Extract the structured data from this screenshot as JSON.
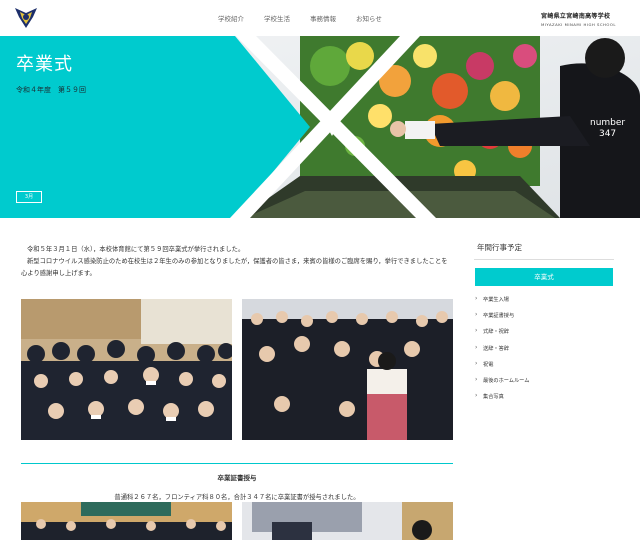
{
  "header": {
    "nav": [
      "学校紹介",
      "学校生活",
      "事務情報",
      "お知らせ"
    ],
    "school_name_jp": "宮崎県立宮崎南高等学校",
    "school_name_en": "MIYAZAKI MINAMI HIGH SCHOOL"
  },
  "hero": {
    "title": "卒業式",
    "subtitle": "令和４年度　第５９回",
    "month_label": "3月",
    "number_label": "number",
    "number_value": "347",
    "accent_color": "#00cbce"
  },
  "intro": [
    "令和５年３月１日（水），本校体育館にて第５９回卒業式が挙行されました。",
    "新型コロナウイルス感染防止のため在校生は２年生のみの参加となりましたが，保護者の皆さま，来賓の皆様のご臨席を賜り，挙行できましたことを心より感謝申し上げます。"
  ],
  "section": {
    "title": "卒業証書授与",
    "text": "普通科２６７名，フロンティア科８０名，合計３４７名に卒業証書が授与されました。"
  },
  "sidebar": {
    "calendar_heading": "年間行事予定",
    "active_item": "卒業式",
    "items": [
      "卒業生入場",
      "卒業証書授与",
      "式辞・祝辞",
      "送辞・答辞",
      "祝電",
      "最後のホームルーム",
      "集合写真"
    ]
  }
}
